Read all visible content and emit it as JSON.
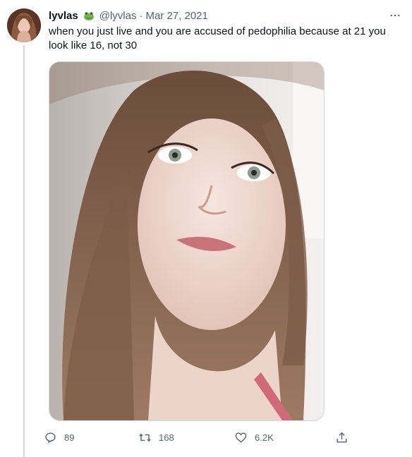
{
  "tweet": {
    "author": {
      "display_name": "lyvlas",
      "emoji_icon": "frog-icon",
      "handle": "@lyvlas",
      "separator": "·",
      "date": "Mar 27, 2021"
    },
    "text": "when you just live and you are accused of pedophilia because at 21 you look like 16, not 30",
    "media": {
      "type": "photo"
    },
    "actions": {
      "reply_count": "89",
      "retweet_count": "168",
      "like_count": "6.2K"
    },
    "icons": {
      "reply": "reply-icon",
      "retweet": "retweet-icon",
      "like": "heart-icon",
      "share": "share-icon",
      "more": "more-icon"
    }
  },
  "colors": {
    "text_primary": "#0f1419",
    "text_secondary": "#536471",
    "border": "#cfd9de",
    "background": "#ffffff"
  }
}
